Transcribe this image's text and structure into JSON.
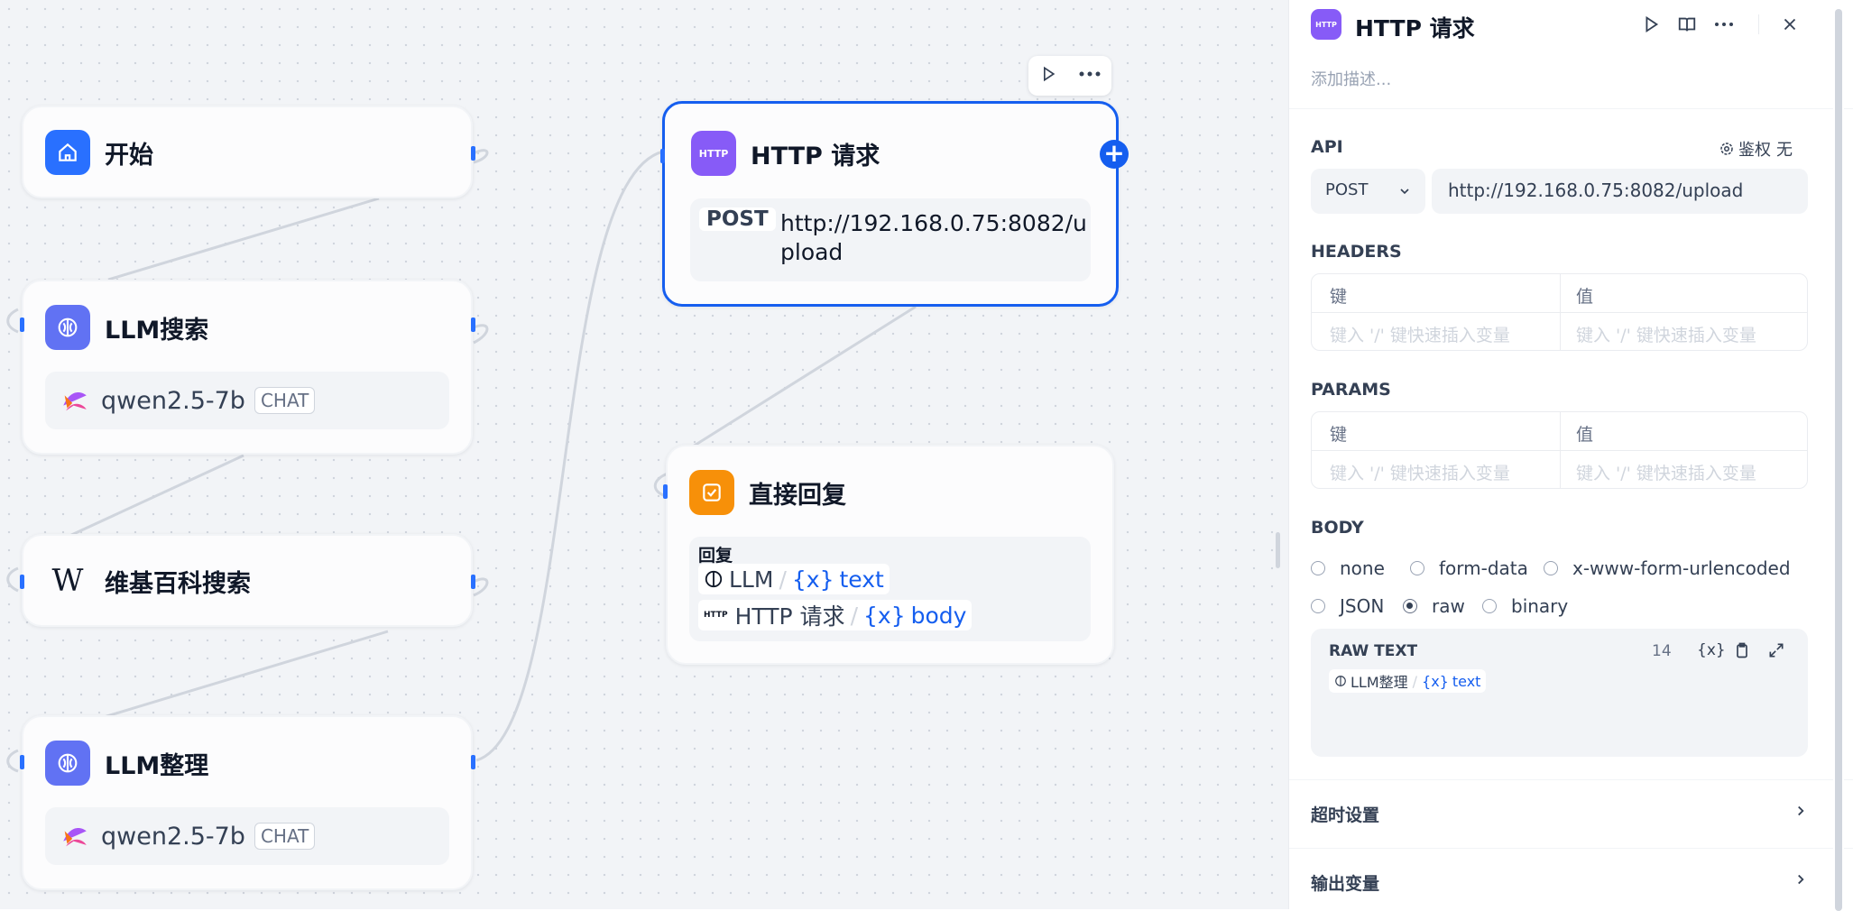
{
  "nodes": {
    "start": {
      "title": "开始",
      "color": "#2970ff"
    },
    "llm_search": {
      "title": "LLM搜索",
      "model": "qwen2.5-7b",
      "mode": "CHAT",
      "color": "#6172f3"
    },
    "wiki": {
      "title": "维基百科搜索",
      "icon_text": "W"
    },
    "llm_organize": {
      "title": "LLM整理",
      "model": "qwen2.5-7b",
      "mode": "CHAT",
      "color": "#6172f3"
    },
    "http": {
      "title": "HTTP 请求",
      "icon_text": "HTTP",
      "method": "POST",
      "url": "http://192.168.0.75:8082/upload",
      "color": "#875bf7"
    },
    "reply": {
      "title": "直接回复",
      "label": "回复",
      "color": "#f79009",
      "vars": [
        {
          "source": "LLM",
          "sep": "/",
          "var": "text"
        },
        {
          "source": "HTTP 请求",
          "sep": "/",
          "var": "body"
        }
      ]
    }
  },
  "panel": {
    "icon_text": "HTTP",
    "title": "HTTP 请求",
    "description_placeholder": "添加描述...",
    "api": {
      "label": "API",
      "auth_label": "鉴权",
      "auth_value": "无",
      "method": "POST",
      "url": "http://192.168.0.75:8082/upload"
    },
    "headers": {
      "label": "HEADERS",
      "key_col": "键",
      "value_col": "值",
      "key_placeholder": "键入 '/' 键快速插入变量",
      "value_placeholder": "键入 '/' 键快速插入变量"
    },
    "params": {
      "label": "PARAMS",
      "key_col": "键",
      "value_col": "值",
      "key_placeholder": "键入 '/' 键快速插入变量",
      "value_placeholder": "键入 '/' 键快速插入变量"
    },
    "body": {
      "label": "BODY",
      "options": [
        "none",
        "form-data",
        "x-www-form-urlencoded",
        "JSON",
        "raw",
        "binary"
      ],
      "selected": "raw",
      "raw_label": "RAW TEXT",
      "char_count": "14",
      "var_source": "LLM整理",
      "var_sep": "/",
      "var_name": "text"
    },
    "timeout_label": "超时设置",
    "output_label": "输出变量"
  }
}
